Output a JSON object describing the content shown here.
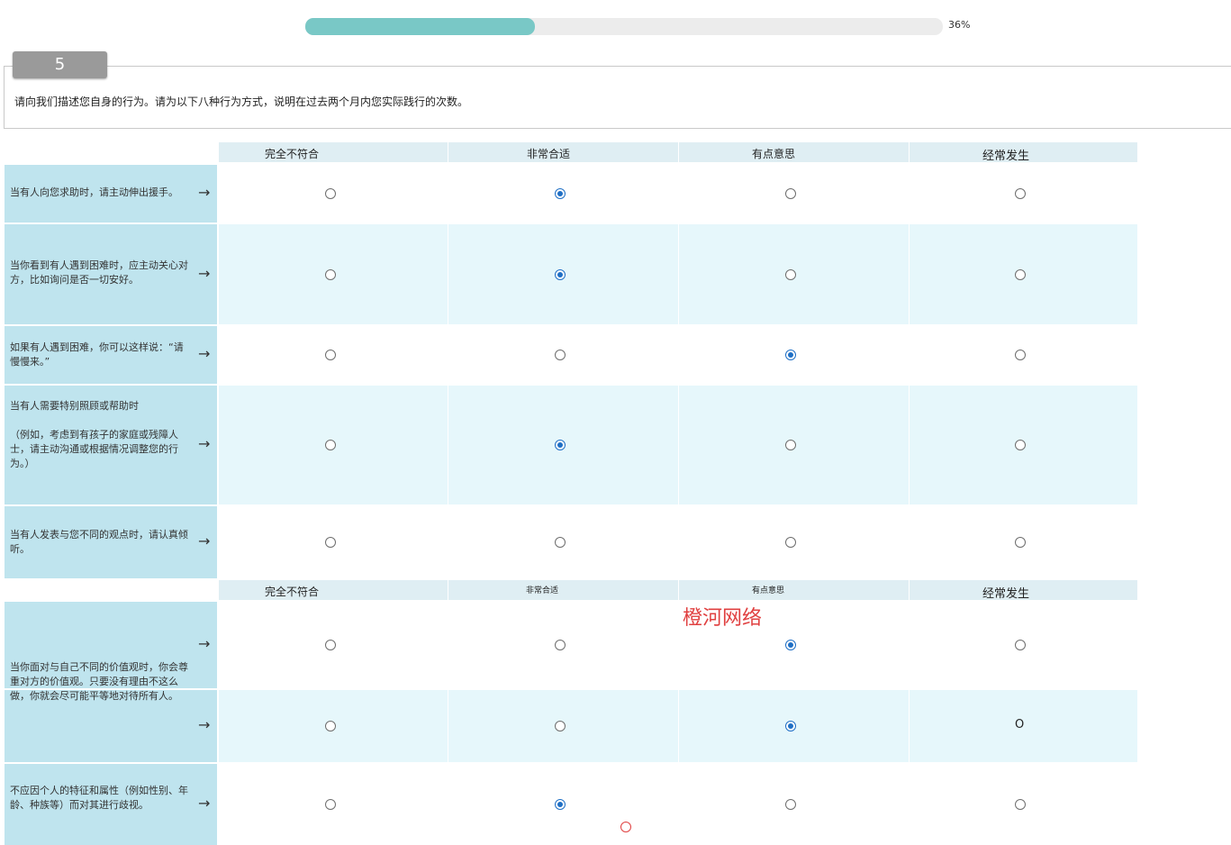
{
  "progress": {
    "percent_label": "36%",
    "value": 0.36,
    "fill_color": "#79c8c6"
  },
  "question": {
    "number": "5",
    "text": "请向我们描述您自身的行为。请为以下八种行为方式，说明在过去两个月内您实际践行的次数。"
  },
  "header_top": [
    "完全不符合",
    "非常合适",
    "有点意思",
    "经常发生"
  ],
  "header_mid": [
    "完全不符合",
    "非常合适",
    "有点意思",
    "经常发生"
  ],
  "rows": [
    {
      "label": "当有人向您求助时，请主动伸出援手。",
      "selected": 1
    },
    {
      "label": "当你看到有人遇到困难时，应主动关心对方，比如询问是否一切安好。",
      "selected": 1
    },
    {
      "label": "如果有人遇到困难，你可以这样说：“请慢慢来。”",
      "selected": 2
    },
    {
      "label": "当有人需要特别照顾或帮助时\n\n（例如，考虑到有孩子的家庭或残障人士，请主动沟通或根据情况调整您的行为。）",
      "selected": 1
    },
    {
      "label": "当有人发表与您不同的观点时，请认真倾听。",
      "selected": -1
    },
    {
      "label": "",
      "selected": 2
    },
    {
      "label": "",
      "selected": 2,
      "last_cell_text": "O"
    },
    {
      "label": "不应因个人的特征和属性（例如性别、年龄、种族等）而对其进行歧视。",
      "selected": 1
    }
  ],
  "overlay_text": "当你面对与自己不同的价值观时，你会尊重对方的价值观。只要没有理由不这么做，你就会尽可能平等地对待所有人。",
  "arrow_glyph": "→",
  "watermark": "橙河网络",
  "colors": {
    "accent": "#1f6fc5",
    "label_bg": "#bfe4ee",
    "alt_row_bg": "#e6f7fb",
    "header_bg": "#dfeef3"
  }
}
